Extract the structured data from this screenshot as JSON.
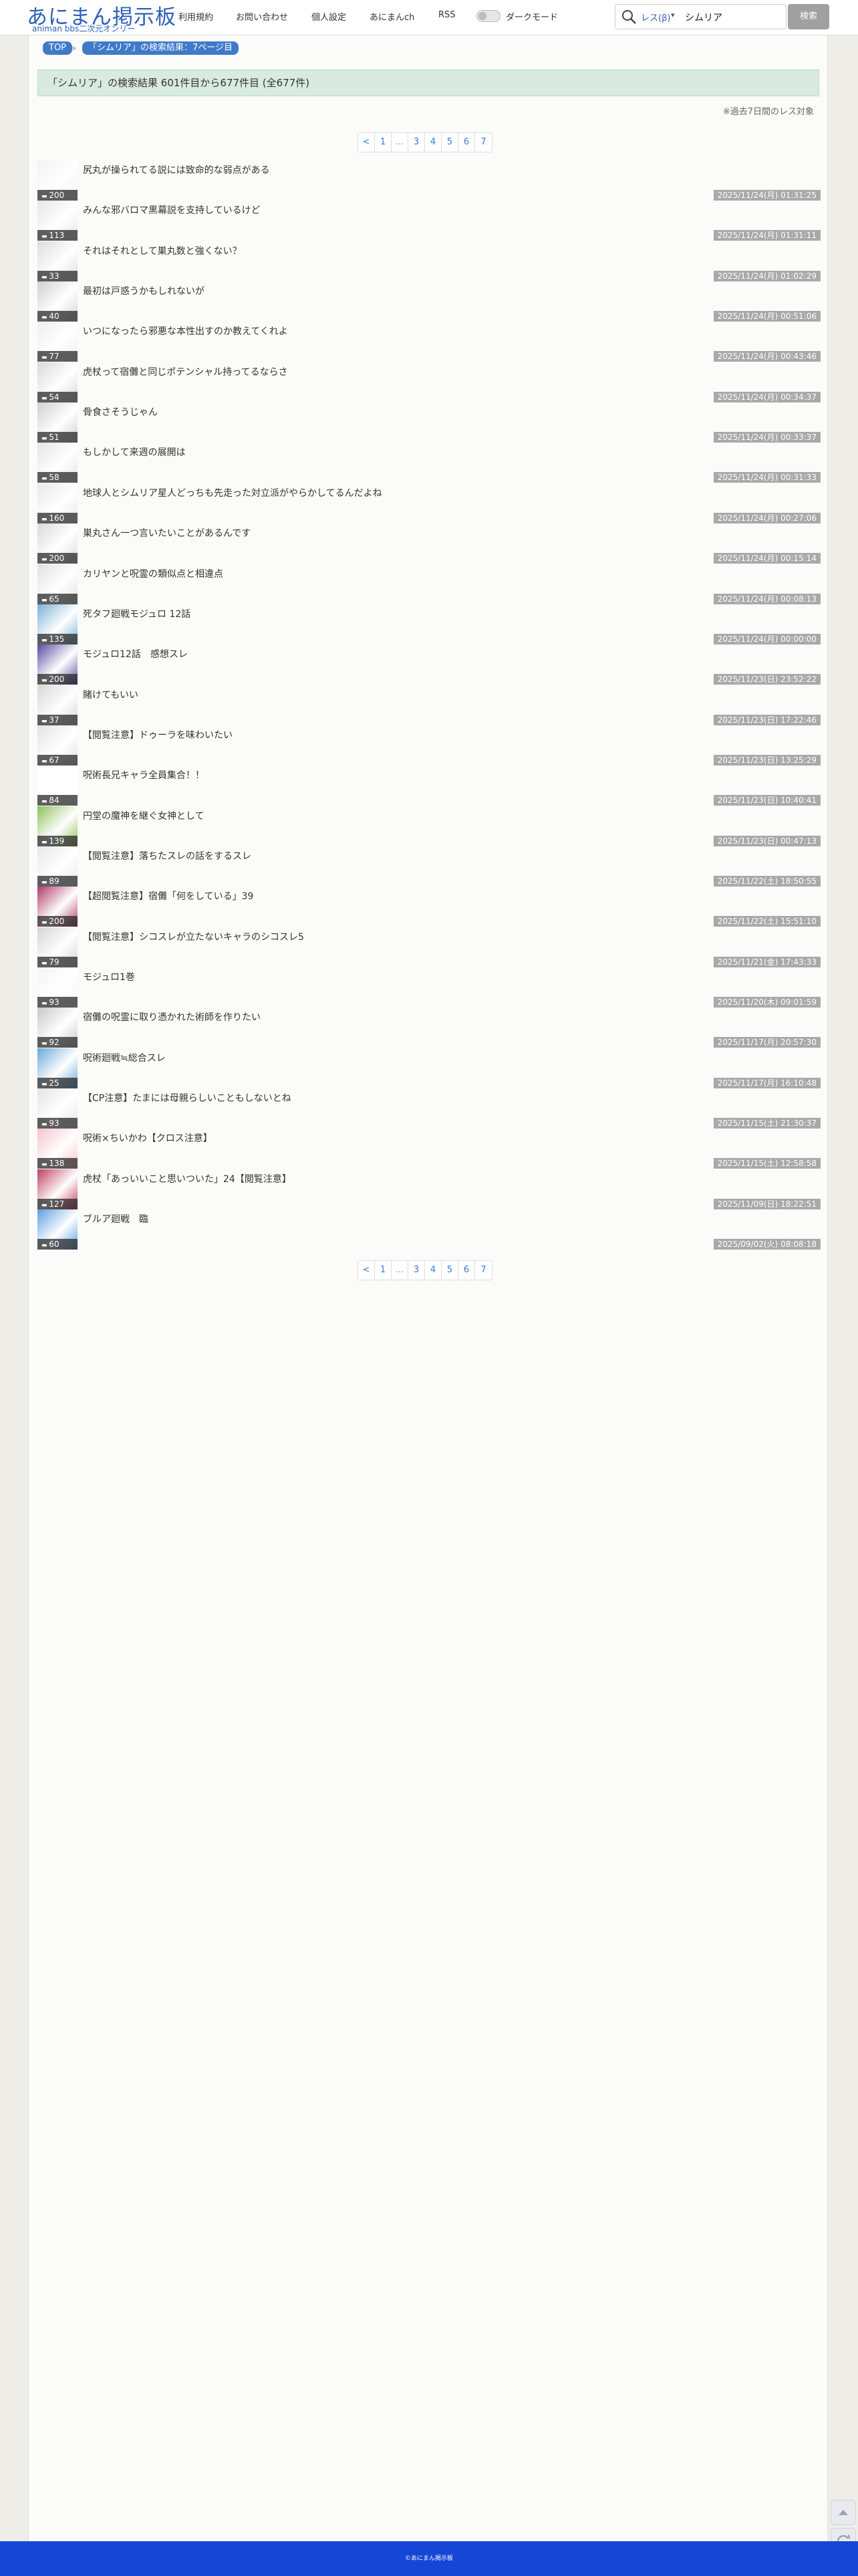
{
  "header": {
    "logo_main": "あにまん掲示板",
    "logo_sub": "animan bbs二次元オンリー",
    "nav": [
      "利用規約",
      "お問い合わせ",
      "個人設定",
      "あにまんch",
      "RSS"
    ],
    "dark_mode_label": "ダークモード",
    "search_mode": "レス(β)",
    "search_query": "シムリア",
    "search_button": "検索"
  },
  "breadcrumb": [
    "TOP",
    "「シムリア」の検索結果：7ページ目"
  ],
  "result_summary": "「シムリア」の検索結果 601件目から677件目 (全677件)",
  "result_note": "※過去7日間のレス対象",
  "pagination": [
    "<",
    "1",
    "...",
    "3",
    "4",
    "5",
    "6",
    "7"
  ],
  "threads": [
    {
      "title": "尻丸が操られてる説には致命的な弱点がある",
      "count": "200",
      "date": "2025/11/24(月) 01:31:25",
      "thumb_color": "#f2f2f2"
    },
    {
      "title": "みんな邪バロマ黒幕説を支持しているけど",
      "count": "113",
      "date": "2025/11/24(月) 01:31:11",
      "thumb_color": "#e6e6e6"
    },
    {
      "title": "それはそれとして巣丸数と強くない？",
      "count": "33",
      "date": "2025/11/24(月) 01:02:29",
      "thumb_color": "#dcdcdc"
    },
    {
      "title": "最初は戸惑うかもしれないが",
      "count": "40",
      "date": "2025/11/24(月) 00:51:06",
      "thumb_color": "#d0d0d0"
    },
    {
      "title": "いつになったら邪悪な本性出すのか教えてくれよ",
      "count": "77",
      "date": "2025/11/24(月) 00:43:46",
      "thumb_color": "#eeeeee"
    },
    {
      "title": "虎杖って宿儺と同じポテンシャル持ってるならさ",
      "count": "54",
      "date": "2025/11/24(月) 00:34:37",
      "thumb_color": "#d8d8d8"
    },
    {
      "title": "骨食さそうじゃん",
      "count": "51",
      "date": "2025/11/24(月) 00:33:37",
      "thumb_color": "#cfcfcf"
    },
    {
      "title": "もしかして来週の展開は",
      "count": "58",
      "date": "2025/11/24(月) 00:31:33",
      "thumb_color": "#e4e4e4"
    },
    {
      "title": "地球人とシムリア星人どっちも先走った対立派がやらかしてるんだよね",
      "count": "160",
      "date": "2025/11/24(月) 00:27:06",
      "thumb_color": "#e9e9e9"
    },
    {
      "title": "巣丸さん一つ言いたいことがあるんです",
      "count": "200",
      "date": "2025/11/24(月) 00:15:14",
      "thumb_color": "#dadada"
    },
    {
      "title": "カリヤンと呪霊の類似点と相違点",
      "count": "65",
      "date": "2025/11/24(月) 00:08:13",
      "thumb_color": "#e0e0e0"
    },
    {
      "title": "死タフ廻戦モジュロ 12話",
      "count": "135",
      "date": "2025/11/24(月) 00:00:00",
      "thumb_color": "#7ab0d6"
    },
    {
      "title": "モジュロ12話　感想スレ",
      "count": "200",
      "date": "2025/11/23(日) 23:52:22",
      "thumb_color": "#5a4aa0"
    },
    {
      "title": "賭けてもいい",
      "count": "37",
      "date": "2025/11/23(日) 17:22:46",
      "thumb_color": "#d6d6d6"
    },
    {
      "title": "【閲覧注意】ドゥーラを味わいたい",
      "count": "67",
      "date": "2025/11/23(日) 13:25:29",
      "thumb_color": "#e2e2e2"
    },
    {
      "title": "呪術長兄キャラ全員集合！！",
      "count": "84",
      "date": "2025/11/23(日) 10:40:41",
      "thumb_color": "#ffffff"
    },
    {
      "title": "円堂の魔神を継ぐ女神として",
      "count": "139",
      "date": "2025/11/23(日) 00:47:13",
      "thumb_color": "#8fbf5a"
    },
    {
      "title": "【閲覧注意】落ちたスレの話をするスレ",
      "count": "89",
      "date": "2025/11/22(土) 18:50:55",
      "thumb_color": "#e8e8e8"
    },
    {
      "title": "【超閲覧注意】宿儺「何をしている」39",
      "count": "200",
      "date": "2025/11/22(土) 15:51:10",
      "thumb_color": "#b03a6a"
    },
    {
      "title": "【閲覧注意】シコスレが立たないキャラのシコスレ5",
      "count": "79",
      "date": "2025/11/21(金) 17:43:33",
      "thumb_color": "#d4d4d4"
    },
    {
      "title": "モジュロ1巻",
      "count": "93",
      "date": "2025/11/20(木) 09:01:59",
      "thumb_color": "#f4f4f4"
    },
    {
      "title": "宿儺の呪霊に取り憑かれた術師を作りたい",
      "count": "92",
      "date": "2025/11/17(月) 20:57:30",
      "thumb_color": "#c8c8c8"
    },
    {
      "title": "呪術廻戦≒総合スレ",
      "count": "25",
      "date": "2025/11/17(月) 16:10:48",
      "thumb_color": "#6aa8d8"
    },
    {
      "title": "【CP注意】たまには母親らしいこともしないとね",
      "count": "93",
      "date": "2025/11/15(土) 21:30:37",
      "thumb_color": "#e4e4e4"
    },
    {
      "title": "呪術×ちいかわ【クロス注意】",
      "count": "138",
      "date": "2025/11/15(土) 12:58:58",
      "thumb_color": "#f4c4cc"
    },
    {
      "title": "虎杖「あっいいこと思いついた」24【閲覧注意】",
      "count": "127",
      "date": "2025/11/09(日) 18:22:51",
      "thumb_color": "#c04060"
    },
    {
      "title": "ブルア廻戦　臨",
      "count": "60",
      "date": "2025/09/02(火) 08:08:18",
      "thumb_color": "#5aa0e0"
    }
  ],
  "footer_text": "©あにまん掲示板",
  "colors": {
    "accent": "#3f7ac8",
    "footer": "#1546d6",
    "banner": "#d9ebe0"
  }
}
